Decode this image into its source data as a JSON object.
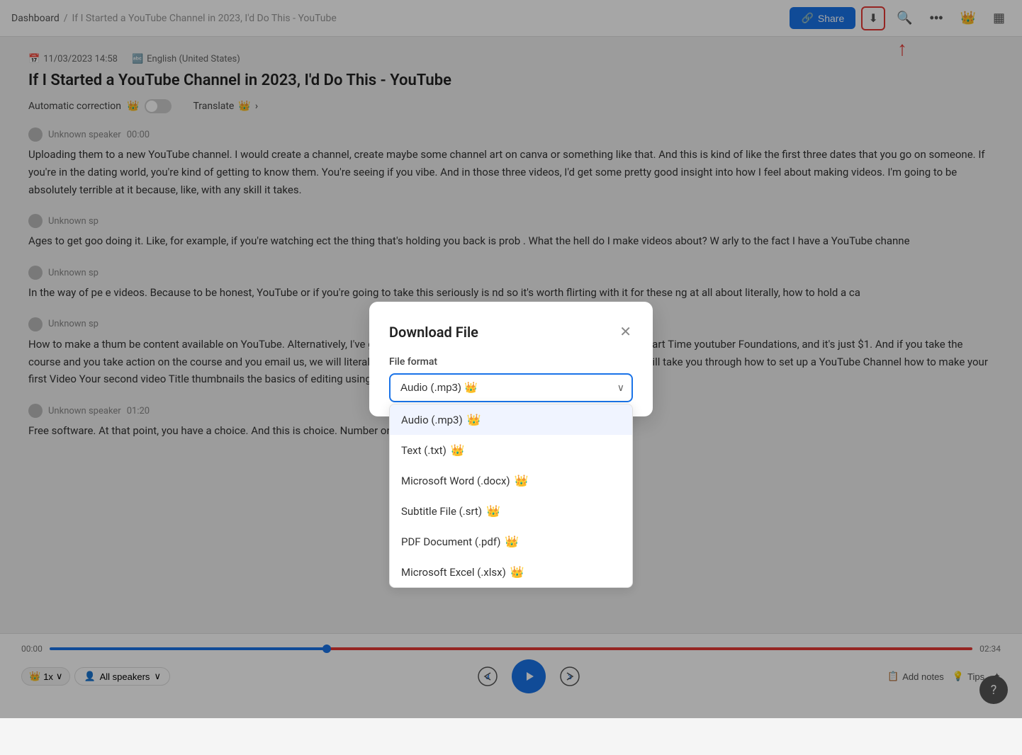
{
  "nav": {
    "breadcrumb_home": "Dashboard",
    "breadcrumb_sep": "/",
    "breadcrumb_current": "If I Started a YouTube Channel in 2023, I'd Do This - YouTube",
    "share_label": "Share",
    "download_icon": "⬇",
    "search_icon": "🔍",
    "more_icon": "•••",
    "crown_icon": "👑",
    "layout_icon": "▦"
  },
  "doc": {
    "date": "11/03/2023 14:58",
    "lang": "English (United States)",
    "title": "If I Started a YouTube Channel in 2023, I'd Do This - YouTube",
    "auto_correction_label": "Automatic correction",
    "translate_label": "Translate",
    "crown": "👑"
  },
  "transcript": [
    {
      "speaker": "Unknown speaker",
      "time": "00:00",
      "text": "Uploading them to a new YouTube channel. I would create a channel, create maybe some channel art on canva or something like that. And this is kind of like the first three dates that you go on someone. If you're in the dating world, you're kind of getting to know them. You're seeing if you vibe. And in those three videos, I'd get some pretty good insight into how I feel about making videos. I'm going to be absolutely terrible at it because, like, with any skill it takes."
    },
    {
      "speaker": "Unknown sp",
      "time": "",
      "text": "Ages to get goo doing it. Like, for example, if you're watching ect the thing that's holding you back is prob . What the hell do I make videos about? W arly to the fact I have a YouTube channe"
    },
    {
      "speaker": "Unknown sp",
      "time": "",
      "text": "In the way of pe e videos. Because to be honest, YouTube or if you're going to take this seriously is nd so it's worth flirting with it for these ng at all about literally, how to hold a ca"
    },
    {
      "speaker": "Unknown sp",
      "time": "",
      "text": "How to make a thum be content available on YouTube. Alternatively, I've got a course that you can take at your own pace. It's called Part Time youtuber Foundations, and it's just $1. And if you take the course and you take action on the course and you email us, we will literally refund you the one dollars that it costs for the course. It will take you through how to set up a YouTube Channel how to make your first Video Your second video Title thumbnails the basics of editing using."
    },
    {
      "speaker": "Unknown speaker",
      "time": "01:20",
      "text": "Free software. At that point, you have a choice. And this is choice. Number one. Hey want to get into the world's bes..."
    }
  ],
  "player": {
    "current_time": "00:00",
    "total_time": "02:34",
    "speed_label": "1x",
    "speakers_label": "All speakers",
    "skip_back_num": "3",
    "skip_fwd_num": "3",
    "add_notes_label": "Add notes",
    "tips_label": "Tips",
    "magic_icon": "✦"
  },
  "modal": {
    "title": "Download File",
    "label": "File format",
    "selected": "Audio (.mp3)",
    "selected_crown": "👑",
    "options": [
      {
        "label": "Audio (.mp3)",
        "crown": true
      },
      {
        "label": "Text (.txt)",
        "crown": true
      },
      {
        "label": "Microsoft Word (.docx)",
        "crown": true
      },
      {
        "label": "Subtitle File (.srt)",
        "crown": true
      },
      {
        "label": "PDF Document (.pdf)",
        "crown": true
      },
      {
        "label": "Microsoft Excel (.xlsx)",
        "crown": true
      }
    ]
  }
}
